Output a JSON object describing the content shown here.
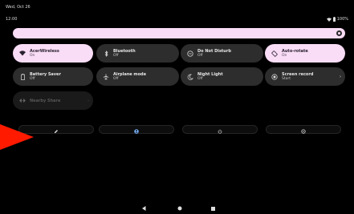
{
  "status_bar": {
    "date": "Wed, Oct 26",
    "time": "12:00",
    "battery": "100%",
    "icons": [
      "wifi-icon",
      "battery-icon"
    ]
  },
  "brightness": {
    "icon": "brightness-icon"
  },
  "tiles": [
    {
      "label": "AcerWireless",
      "state": "On",
      "icon": "wifi-icon",
      "active": true
    },
    {
      "label": "Bluetooth",
      "state": "Off",
      "icon": "bluetooth-icon",
      "active": false
    },
    {
      "label": "Do Not Disturb",
      "state": "Off",
      "icon": "do-not-disturb-icon",
      "active": false
    },
    {
      "label": "Auto-rotate",
      "state": "On",
      "icon": "auto-rotate-icon",
      "active": true
    },
    {
      "label": "Battery Saver",
      "state": "Off",
      "icon": "battery-saver-icon",
      "active": false
    },
    {
      "label": "Airplane mode",
      "state": "Off",
      "icon": "airplane-icon",
      "active": false
    },
    {
      "label": "Night Light",
      "state": "Off",
      "icon": "night-light-icon",
      "active": false
    },
    {
      "label": "Screen record",
      "state": "Start",
      "icon": "screen-record-icon",
      "active": false
    },
    {
      "label": "Nearby Share",
      "state": "",
      "icon": "nearby-share-icon",
      "active": false
    }
  ],
  "bottom_actions": [
    "edit-icon",
    "user-icon",
    "power-icon",
    "settings-icon"
  ],
  "nav": [
    "back-icon",
    "home-icon",
    "recents-icon"
  ],
  "colors": {
    "active_tile": "#f9dcf6",
    "inactive_tile": "#2d2d2d",
    "background": "#000000",
    "pointer": "#ff1a00"
  }
}
